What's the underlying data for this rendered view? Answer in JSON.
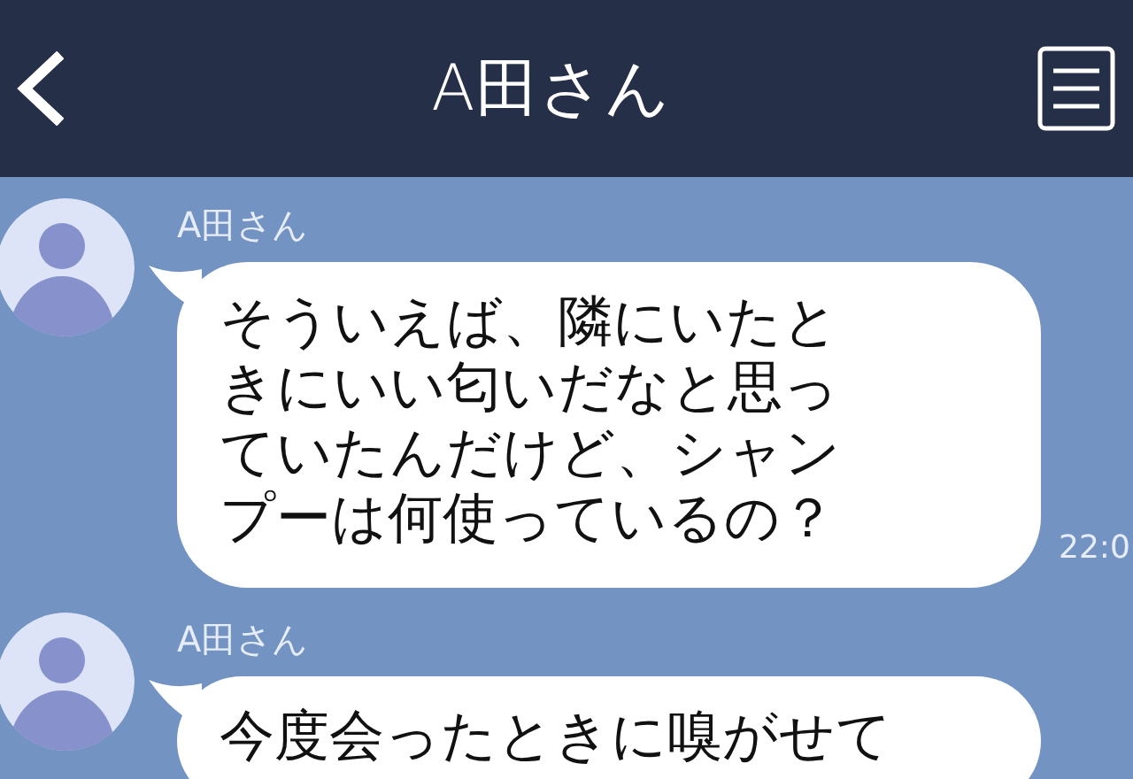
{
  "header": {
    "title": "A田さん"
  },
  "messages": [
    {
      "sender": "A田さん",
      "text": "そういえば、隣にいたときにいい匂いだなと思っていたんだけど、シャンプーは何使っているの？",
      "time": "22:0"
    },
    {
      "sender": "A田さん",
      "text": "今度会ったときに嗅がせて"
    }
  ]
}
